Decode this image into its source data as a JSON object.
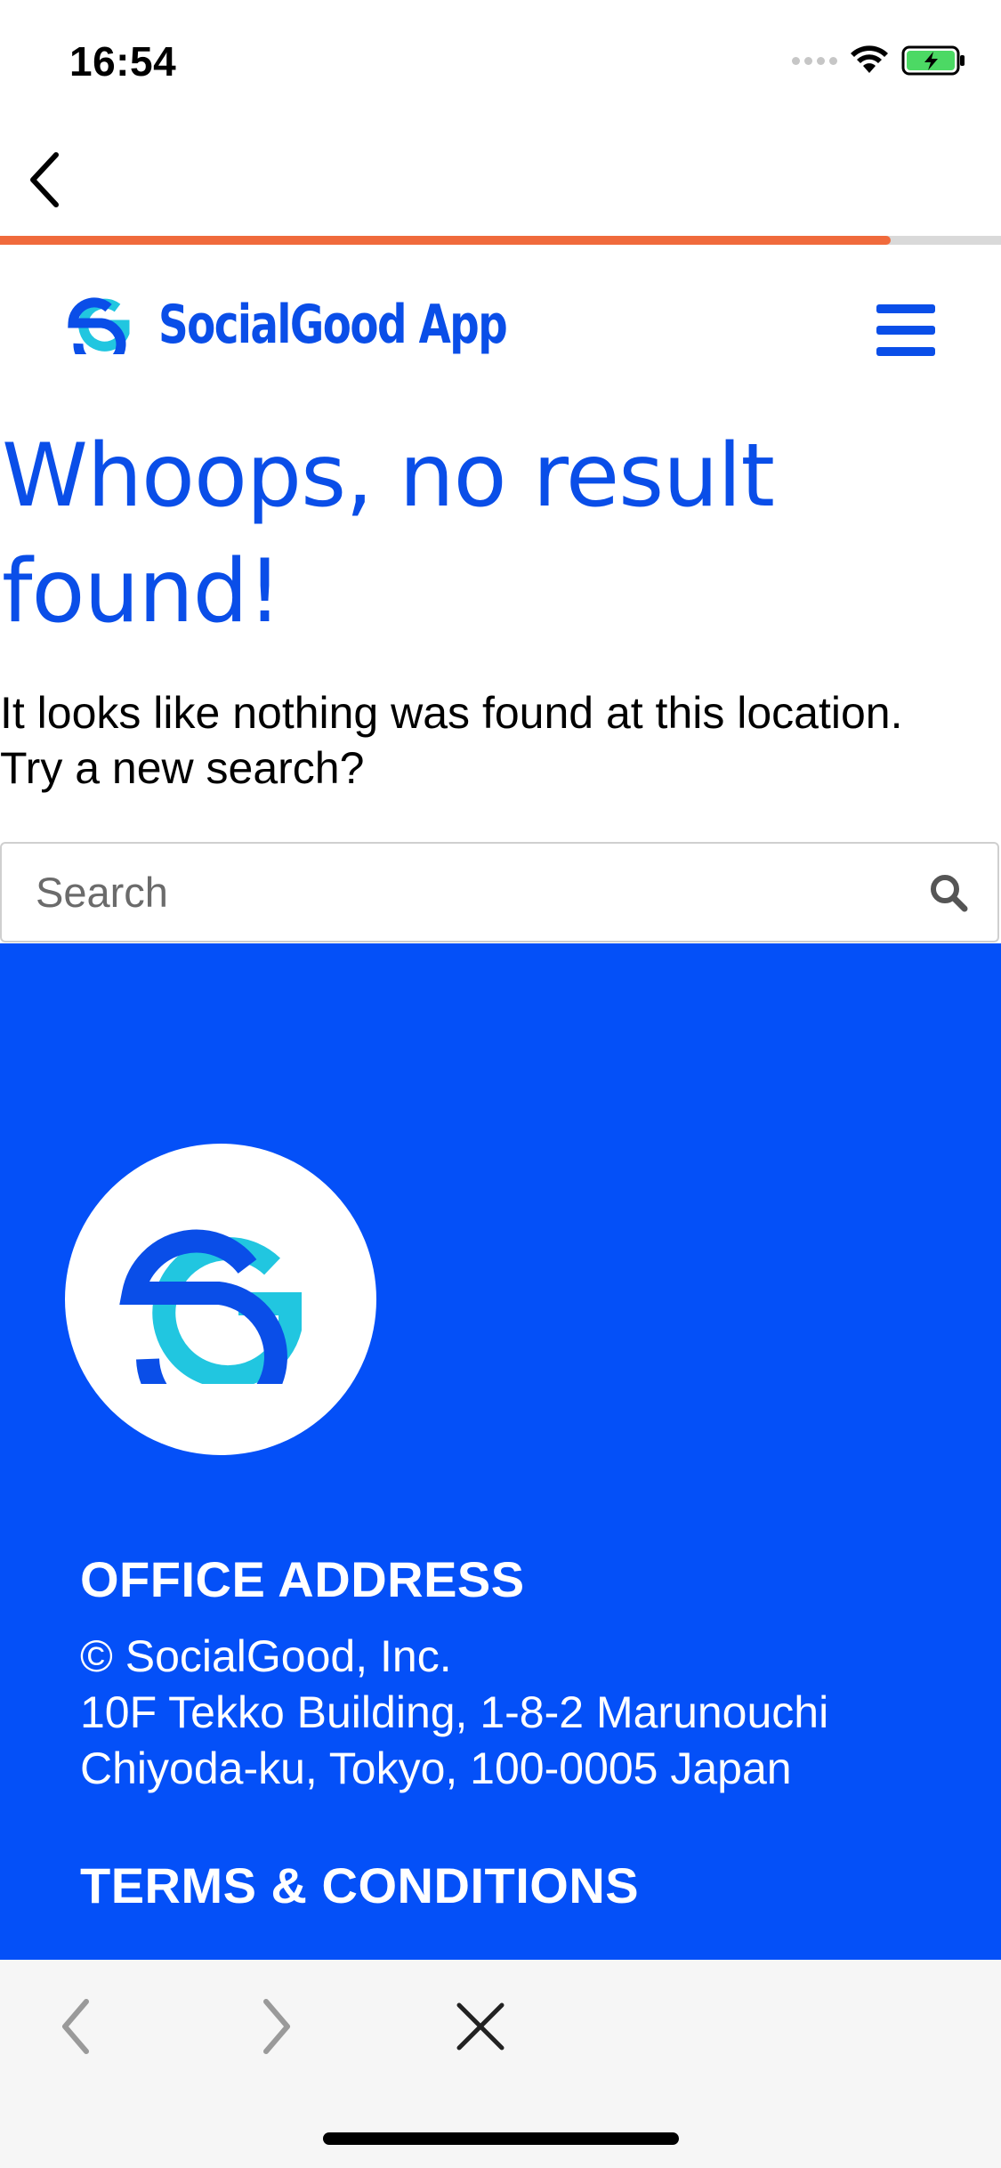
{
  "status_bar": {
    "time": "16:54",
    "signal_icon": "cellular-signal-icon",
    "wifi_icon": "wifi-icon",
    "battery_icon": "battery-charging-icon",
    "battery_color": "#4cd964"
  },
  "top_nav": {
    "back_icon": "chevron-left-icon",
    "page_load_progress": 0.89,
    "progress_color": "#f06a3c"
  },
  "header": {
    "brand_name": "SocialGood App",
    "logo_icon": "socialgood-logo-icon",
    "menu_icon": "hamburger-menu-icon",
    "brand_color": "#0a4ee8"
  },
  "main": {
    "title": "Whoops, no result found!",
    "message_line1": "It looks like nothing was found at this location.",
    "message_line2": "Try a new search?",
    "search": {
      "placeholder": "Search",
      "value": "",
      "icon": "search-icon"
    }
  },
  "footer": {
    "background": "#0450f8",
    "office_heading": "OFFICE ADDRESS",
    "address_lines": [
      "© SocialGood, Inc.",
      "10F Tekko Building, 1-8-2 Marunouchi",
      "Chiyoda-ku, Tokyo, 100-0005 Japan"
    ],
    "terms_heading": "TERMS & CONDITIONS"
  },
  "browser_toolbar": {
    "back_icon": "chevron-left-icon",
    "forward_icon": "chevron-right-icon",
    "close_icon": "close-icon"
  }
}
